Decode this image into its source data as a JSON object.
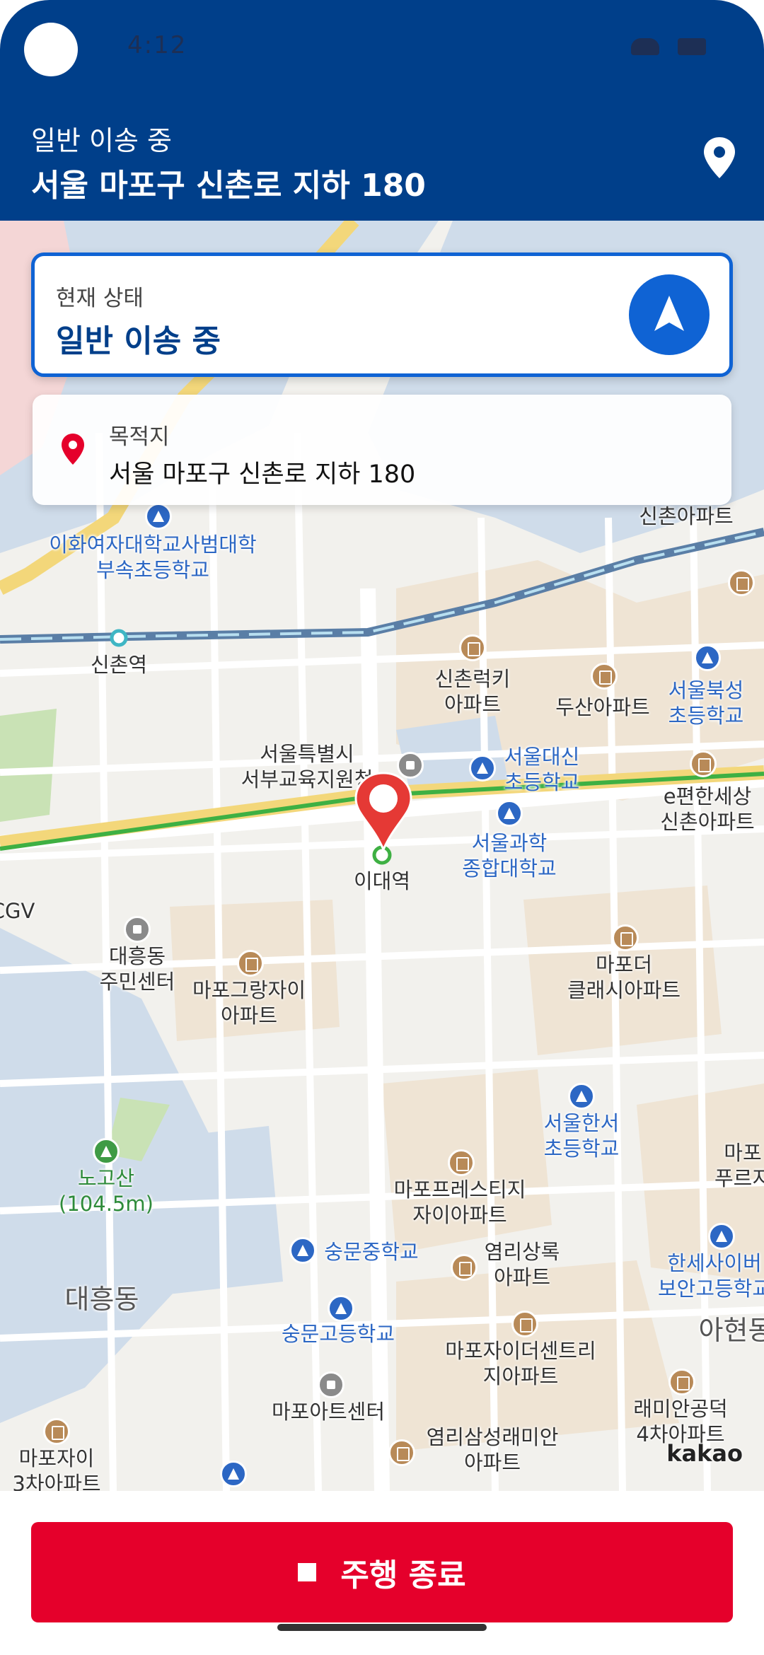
{
  "status_bar": {
    "time": "4:12"
  },
  "header": {
    "subtitle": "일반 이송 중",
    "title": "서울 마포구 신촌로 지하 180",
    "icon": "location-pin-icon"
  },
  "status_card": {
    "label": "현재 상태",
    "value": "일반 이송 중",
    "nav_icon": "navigation-arrow-icon"
  },
  "destination_card": {
    "label": "목적지",
    "value": "서울 마포구 신촌로 지하 180",
    "icon": "location-pin-icon"
  },
  "map": {
    "attribution": "kakao",
    "labels": {
      "sinchon_station": "신촌역",
      "idae_station": "이대역",
      "ewha_elem": "이화여자대학교사범대학\n부속초등학교",
      "sinchon_lucky": "신촌럭키\n아파트",
      "doosan": "두산아파트",
      "seoul_bukseong": "서울북성\n초등학교",
      "seoul_edu": "서울특별시\n서부교육지원청",
      "seoul_daesin": "서울대신\n초등학교",
      "e_pyunhan": "e편한세상\n신촌아파트",
      "seoul_science": "서울과학\n종합대학교",
      "daeheung_center": "대흥동\n주민센터",
      "mapo_grandxi": "마포그랑자이\n아파트",
      "mapo_the_classy": "마포더\n클래시아파트",
      "seoul_hanseo": "서울한서\n초등학교",
      "nogosan": "노고산\n(104.5m)",
      "mapo_prestige": "마포프레스티지\n자이아파트",
      "soongmoon_middle": "숭문중학교",
      "yeomni_sangrok": "염리상록\n아파트",
      "daeheung_dong": "대흥동",
      "soongmoon_high": "숭문고등학교",
      "mapo_the_centerville": "마포자이더센트리\n지아파트",
      "mapo_art_center": "마포아트센터",
      "yeomni_samsung": "염리삼성래미안\n아파트",
      "raemian_4": "래미안공덕\n4차아파트",
      "mapo_xi_3": "마포자이\n3차아파트",
      "hanse_cyber": "한세사이버\n보안고등학교",
      "ahyeon": "아현동",
      "mapo_edge": "마포\n푸르지",
      "sinchon_apt_top": "신촌아파트",
      "cgv": "CGV"
    }
  },
  "end_button": {
    "label": "주행 종료",
    "icon": "stop-icon"
  },
  "colors": {
    "header_bg": "#003f8a",
    "accent_blue": "#0f63d4",
    "end_button_red": "#e5002b",
    "marker_red": "#e53935",
    "line2_green": "#3eb043",
    "gyeongui_line": "#77c4d9"
  }
}
